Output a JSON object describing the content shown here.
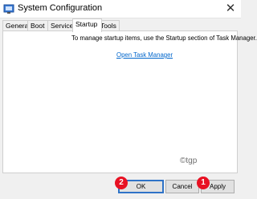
{
  "window": {
    "title": "System Configuration",
    "close_glyph": "✕",
    "icon": "system-configuration-icon"
  },
  "tabs": [
    {
      "label": "General"
    },
    {
      "label": "Boot"
    },
    {
      "label": "Services"
    },
    {
      "label": "Startup",
      "active": true
    },
    {
      "label": "Tools"
    }
  ],
  "startup": {
    "description": "To manage startup items, use the Startup section of Task Manager.",
    "link": "Open Task Manager"
  },
  "watermark": "©tgp",
  "buttons": {
    "ok": "OK",
    "cancel": "Cancel",
    "apply": "Apply"
  },
  "markers": {
    "ok": "2",
    "apply": "1"
  },
  "colors": {
    "marker": "#e81123",
    "link": "#0066cc"
  }
}
